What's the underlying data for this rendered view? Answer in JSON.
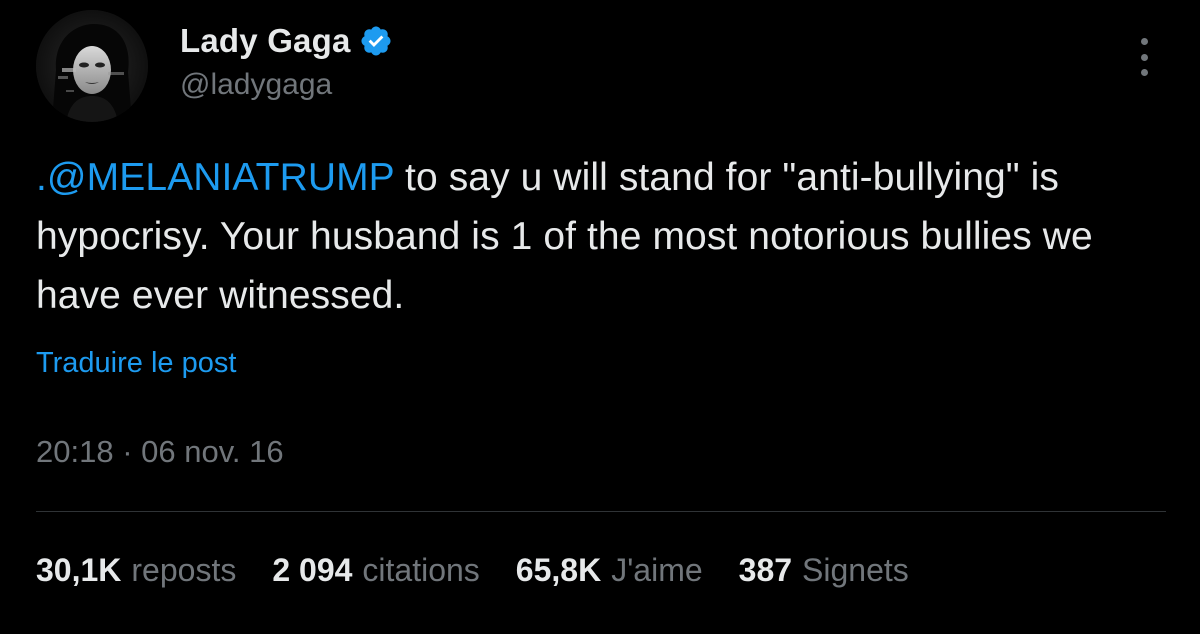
{
  "author": {
    "display_name": "Lady Gaga",
    "handle": "@ladygaga",
    "verified": true,
    "verified_color": "#1d9bf0",
    "avatar_icon": "profile-photo-avatar"
  },
  "menu": {
    "icon": "more-options-icon"
  },
  "tweet": {
    "mention": ".@MELANIATRUMP",
    "text_after_mention": " to say u will stand for \"anti-bullying\" is hypocrisy. Your husband is 1 of the most notorious bullies we have ever witnessed."
  },
  "translate_label": "Traduire le post",
  "timestamp": "20:18 · 06 nov. 16",
  "stats": [
    {
      "count": "30,1K",
      "label": "reposts"
    },
    {
      "count": "2 094",
      "label": "citations"
    },
    {
      "count": "65,8K",
      "label": "J'aime"
    },
    {
      "count": "387",
      "label": "Signets"
    }
  ],
  "colors": {
    "background": "#000000",
    "text": "#e7e9ea",
    "muted": "#71767b",
    "accent": "#1d9bf0",
    "divider": "#2f3336"
  }
}
